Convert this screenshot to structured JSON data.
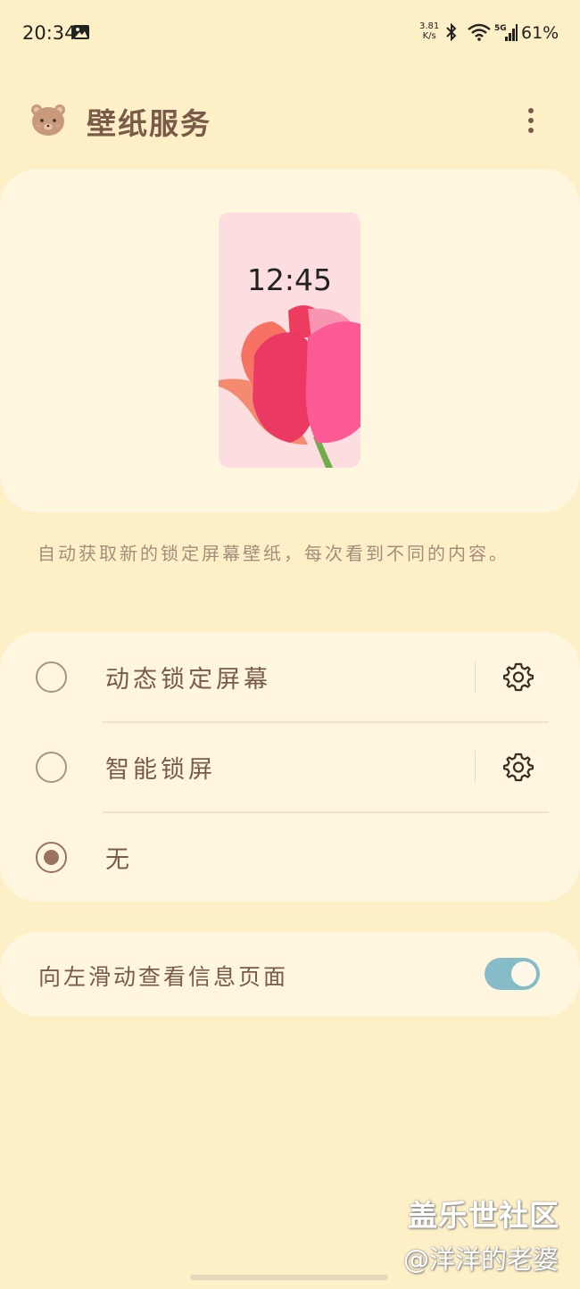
{
  "status_bar": {
    "time": "20:34",
    "net_speed_value": "3.81",
    "net_speed_unit": "K/s",
    "network_type": "5G",
    "battery": "61%"
  },
  "header": {
    "title": "壁纸服务",
    "icon": "bear-icon",
    "menu_icon": "more-vertical-icon"
  },
  "preview": {
    "clock": "12:45"
  },
  "description": "自动获取新的锁定屏幕壁纸，每次看到不同的内容。",
  "options": [
    {
      "label": "动态锁定屏幕",
      "selected": false,
      "has_settings": true
    },
    {
      "label": "智能锁屏",
      "selected": false,
      "has_settings": true
    },
    {
      "label": "无",
      "selected": true,
      "has_settings": false
    }
  ],
  "swipe_setting": {
    "label": "向左滑动查看信息页面",
    "enabled": true
  },
  "watermark": {
    "line1": "盖乐世社区",
    "line2": "@洋洋的老婆"
  },
  "colors": {
    "background": "#fdefc6",
    "card": "#fef6df",
    "text": "#7a5a48",
    "toggle_on": "#86bcc8"
  }
}
